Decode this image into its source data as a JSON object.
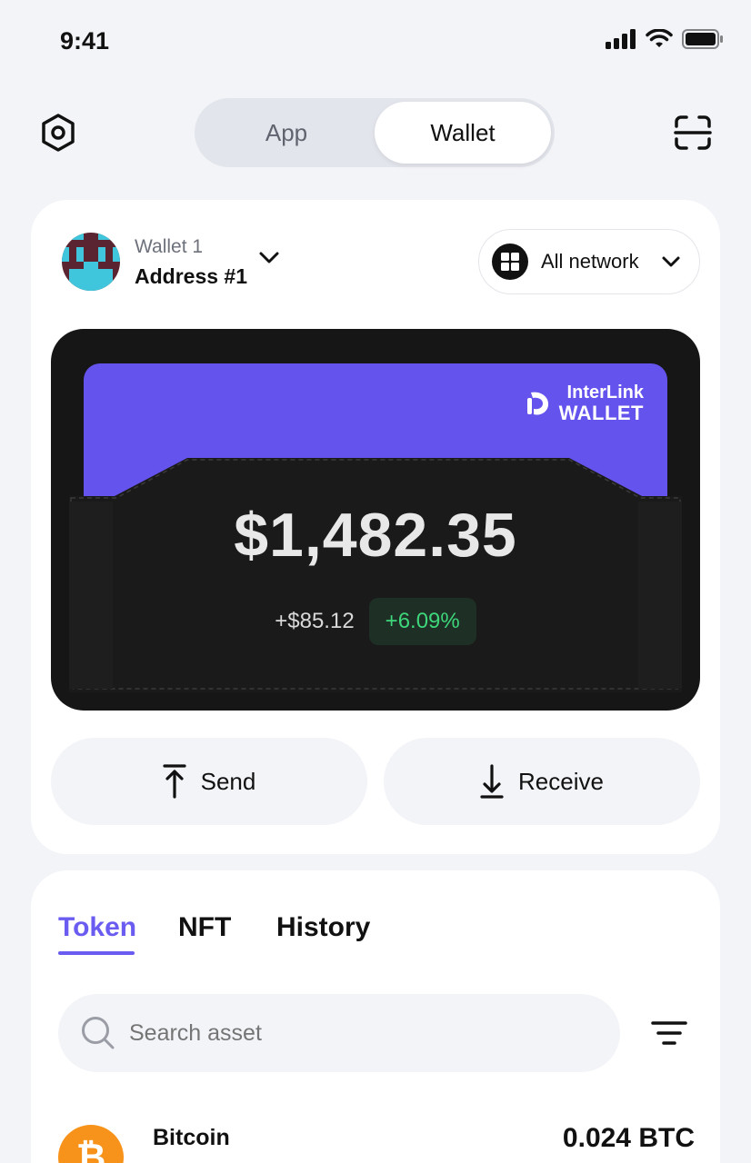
{
  "status_bar": {
    "time": "9:41",
    "icons": [
      "signal-icon",
      "wifi-icon",
      "battery-icon"
    ]
  },
  "header": {
    "settings_icon": "settings-hexagon-icon",
    "scan_icon": "scan-icon",
    "segments": [
      {
        "label": "App",
        "active": false
      },
      {
        "label": "Wallet",
        "active": true
      }
    ]
  },
  "wallet": {
    "name": "Wallet 1",
    "address": "Address #1",
    "network_label": "All network",
    "brand_line1": "InterLink",
    "brand_line2": "WALLET",
    "balance": "$1,482.35",
    "change_amount": "+$85.12",
    "change_percent": "+6.09%"
  },
  "actions": {
    "send_label": "Send",
    "receive_label": "Receive"
  },
  "assets": {
    "tabs": [
      {
        "label": "Token",
        "active": true
      },
      {
        "label": "NFT",
        "active": false
      },
      {
        "label": "History",
        "active": false
      }
    ],
    "search_placeholder": "Search asset",
    "tokens": [
      {
        "name": "Bitcoin",
        "amount": "0.024 BTC",
        "icon": "bitcoin-icon",
        "symbol_glyph": "₿"
      }
    ]
  },
  "colors": {
    "accent": "#6a5cf0",
    "brand_card": "#6553ee",
    "positive": "#3ed67a",
    "bitcoin": "#f7931a",
    "background": "#f3f4f8"
  }
}
